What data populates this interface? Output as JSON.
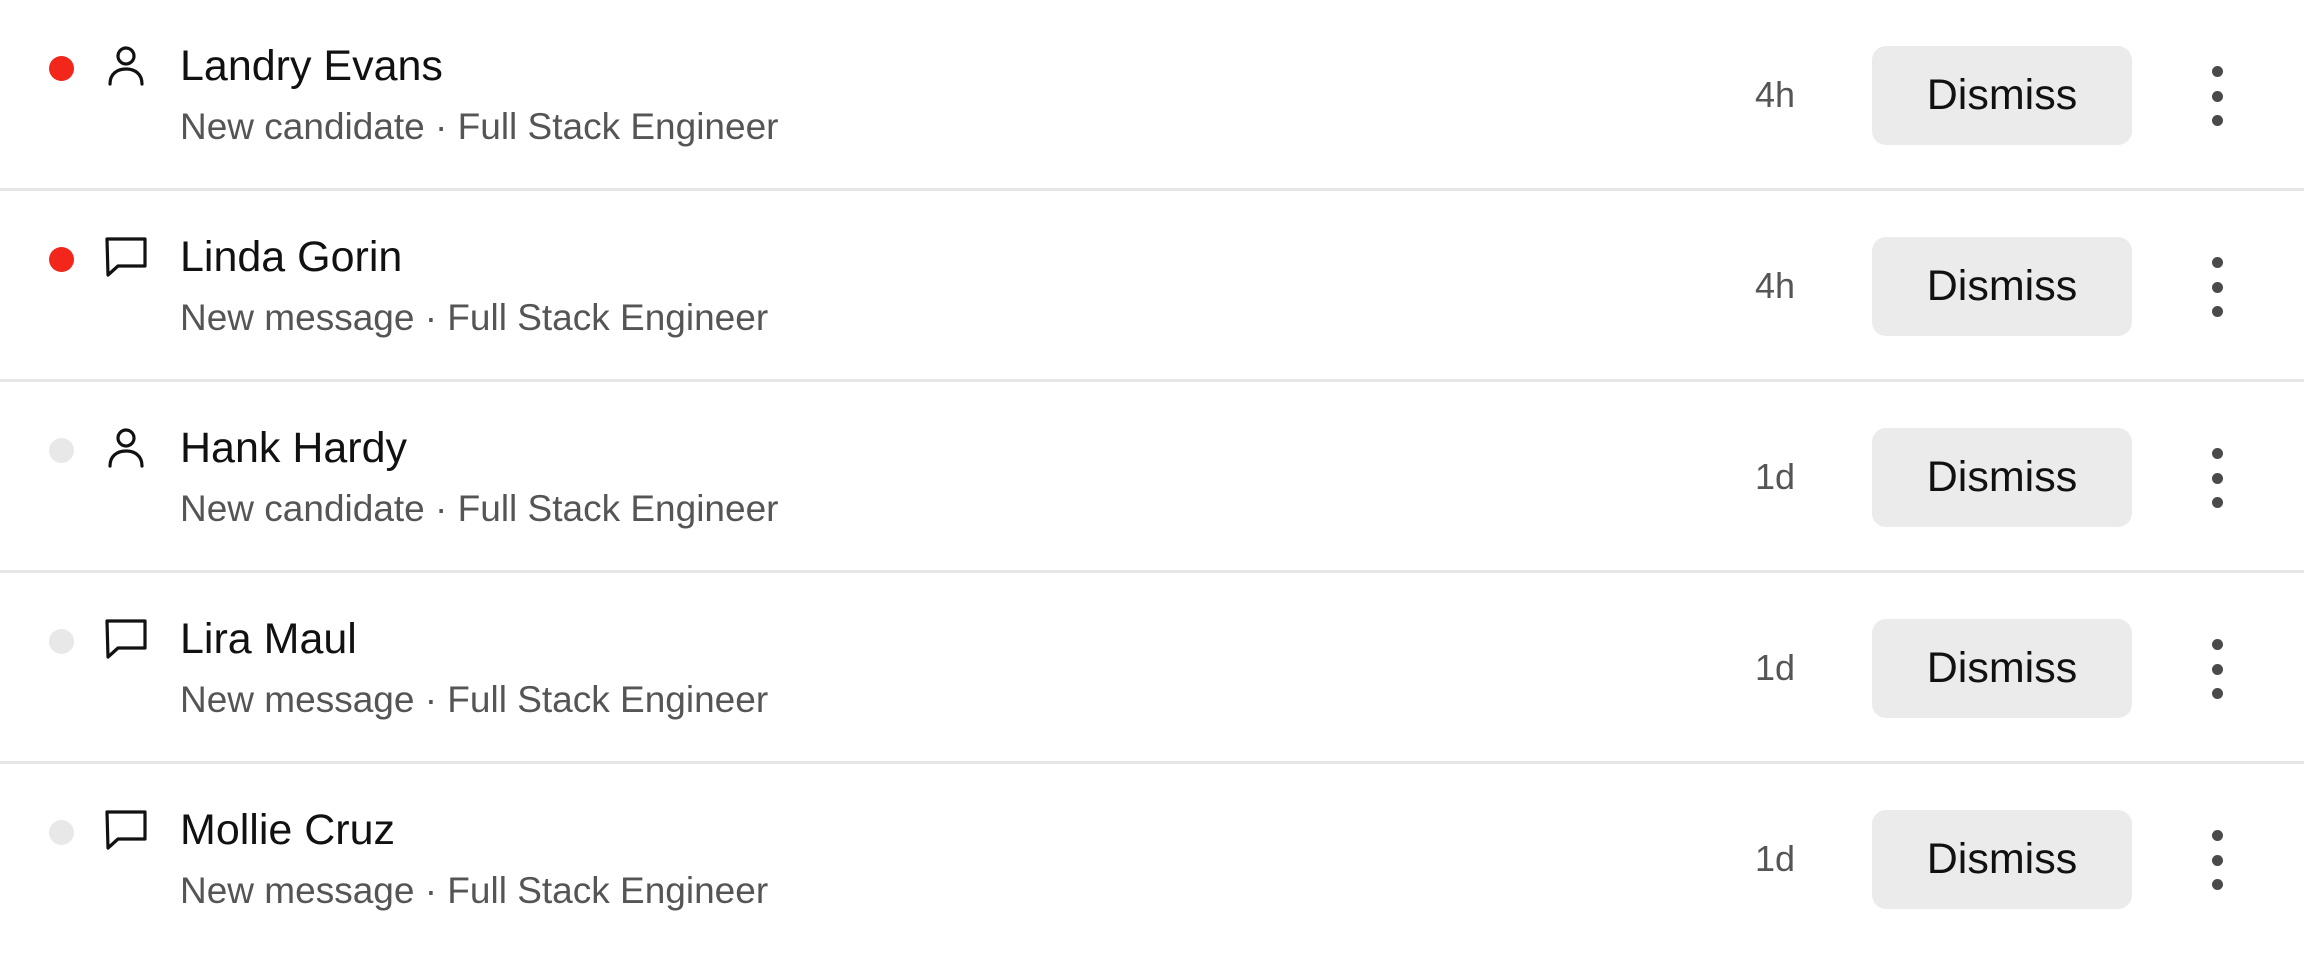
{
  "notifications": [
    {
      "read": false,
      "type_icon": "person-icon",
      "name": "Landry Evans",
      "subtitle": "New candidate · Full Stack Engineer",
      "time": "4h",
      "action_label": "Dismiss"
    },
    {
      "read": false,
      "type_icon": "message-icon",
      "name": "Linda Gorin",
      "subtitle": "New message · Full Stack Engineer",
      "time": "4h",
      "action_label": "Dismiss"
    },
    {
      "read": true,
      "type_icon": "person-icon",
      "name": "Hank Hardy",
      "subtitle": "New candidate · Full Stack Engineer",
      "time": "1d",
      "action_label": "Dismiss"
    },
    {
      "read": true,
      "type_icon": "message-icon",
      "name": "Lira Maul",
      "subtitle": "New message · Full Stack Engineer",
      "time": "1d",
      "action_label": "Dismiss"
    },
    {
      "read": true,
      "type_icon": "message-icon",
      "name": "Mollie Cruz",
      "subtitle": "New message · Full Stack Engineer",
      "time": "1d",
      "action_label": "Dismiss"
    }
  ],
  "colors": {
    "unread_dot": "#f2261a",
    "read_dot": "#e8e8e8",
    "button_bg": "#ebebeb",
    "divider": "#e6e6e6"
  }
}
